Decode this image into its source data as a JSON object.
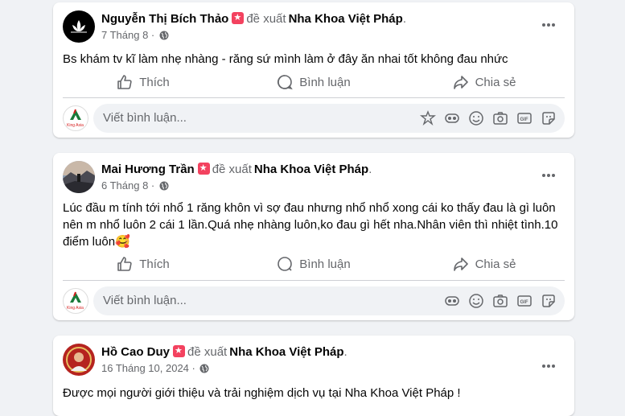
{
  "posts": [
    {
      "author": "Nguyễn Thị Bích Thảo",
      "verb": "đề xuất",
      "page": "Nha Khoa Việt Pháp",
      "date": "7 Tháng 8",
      "text": "Bs khám tv kĩ làm nhẹ nhàng - răng sứ mình làm ở đây ăn nhai tốt không đau nhức",
      "emoji": "",
      "avatar_icon": "lotus-avatar"
    },
    {
      "author": "Mai Hương Trần",
      "verb": "đề xuất",
      "page": "Nha Khoa Việt Pháp",
      "date": "6 Tháng 8",
      "text": "Lúc đầu m tính tới nhổ 1 răng khôn vì sợ đau nhưng nhổ nhổ xong cái ko thấy đau là gì luôn nên m nhổ luôn 2 cái 1 lần.Quá nhẹ nhàng luôn,ko đau gì hết nha.Nhân viên thì nhiệt tình.10 điểm luôn",
      "emoji": "🥰",
      "avatar_icon": "landscape-avatar"
    },
    {
      "author": "Hồ Cao Duy",
      "verb": "đề xuất",
      "page": "Nha Khoa Việt Pháp",
      "date": "16 Tháng 10, 2024",
      "text": "Được mọi người giới thiệu và trải nghiệm dịch vụ tại Nha Khoa Việt Pháp !",
      "emoji": "",
      "avatar_icon": "person-avatar"
    }
  ],
  "actions": {
    "like": "Thích",
    "comment": "Bình luận",
    "share": "Chia sẻ"
  },
  "comment_placeholder": "Viết bình luận...",
  "commenter_logo": "King Asia",
  "colors": {
    "recommend_badge": "#f3425f",
    "secondary_text": "#65676b",
    "background": "#f0f2f5"
  }
}
